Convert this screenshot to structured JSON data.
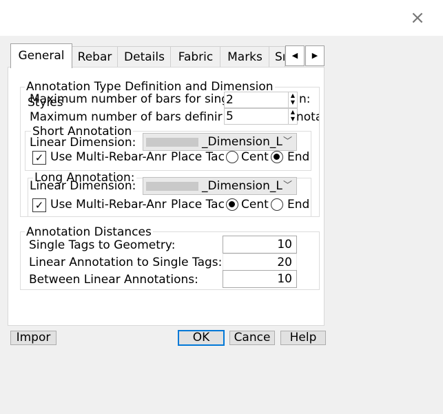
{
  "window": {
    "close_glyph": "×"
  },
  "tabs": [
    {
      "label": "General",
      "active": true
    },
    {
      "label": "Rebar"
    },
    {
      "label": "Details"
    },
    {
      "label": "Fabric"
    },
    {
      "label": "Marks"
    },
    {
      "label": "Sı"
    }
  ],
  "tab_scroll": {
    "left": "◀",
    "right": "▶"
  },
  "annotation_type": {
    "title_line1": "Annotation Type Definition and Dimension",
    "title_line2": "Styles",
    "max_bars_single_label": "Maximum number of bars for sing",
    "max_bars_single_label_tail": "n:",
    "max_bars_single_value": "2",
    "max_bars_defining_label": "Maximum number of bars definir",
    "max_bars_defining_label_tail": "nota",
    "max_bars_defining_value": "5",
    "short": {
      "title": "Short Annotation",
      "linear_dimension_label": "Linear Dimension:",
      "linear_dimension_value": "_Dimension_L",
      "use_multi_rebar_label": "Use Multi-Rebar-Anr",
      "use_multi_rebar_checked": true,
      "place_tag_label": "Place Tac",
      "center_label": "Cent",
      "end_label": "End",
      "selected": "end"
    },
    "long": {
      "title": "Long Annotation:",
      "linear_dimension_label": "Linear Dimension:",
      "linear_dimension_value": "_Dimension_L",
      "use_multi_rebar_label": "Use Multi-Rebar-Anr",
      "use_multi_rebar_checked": true,
      "place_tag_label": "Place Tac",
      "center_label": "Cent",
      "end_label": "End",
      "selected": "center"
    }
  },
  "annotation_distances": {
    "title": "Annotation Distances",
    "rows": [
      {
        "label": "Single Tags to Geometry:",
        "value": "10"
      },
      {
        "label": "Linear Annotation to Single Tags:",
        "value": "20"
      },
      {
        "label": "Between Linear Annotations:",
        "value": "10"
      }
    ]
  },
  "buttons": {
    "import": "Impor",
    "ok": "OK",
    "cancel": "Cance",
    "help": "Help"
  },
  "icons": {
    "checkmark": "✓",
    "spin_up": "▲",
    "spin_down": "▼",
    "dropdown": "﹀"
  }
}
